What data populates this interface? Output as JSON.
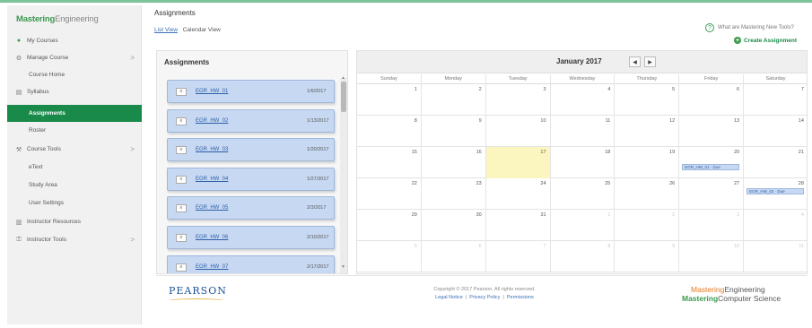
{
  "app": {
    "logo_primary": "Mastering",
    "logo_secondary": "Engineering",
    "accent": "#1a8a4a",
    "brand_green": "#3a9a4e"
  },
  "sidebar": {
    "items": [
      {
        "label": "My Courses",
        "icon": "home-icon"
      },
      {
        "label": "Manage Course",
        "icon": "wrench-icon",
        "chevron": ">"
      },
      {
        "label": "Course Home"
      },
      {
        "label": "Syllabus",
        "icon": "document-icon"
      },
      {
        "label": "Assignments",
        "active": true
      },
      {
        "label": "Roster"
      },
      {
        "label": "Course Tools",
        "icon": "tools-icon",
        "chevron": ">"
      },
      {
        "label": "eText"
      },
      {
        "label": "Study Area"
      },
      {
        "label": "User Settings"
      },
      {
        "label": "Instructor Resources",
        "icon": "book-icon"
      },
      {
        "label": "Instructor Tools",
        "icon": "key-icon",
        "chevron": ">"
      }
    ]
  },
  "header": {
    "title": "Assignments",
    "view_list": "List View",
    "view_calendar": "Calendar View",
    "whats_new": "What are Mastering New Tools?",
    "create_assignment": "Create Assignment"
  },
  "assignments": {
    "heading": "Assignments",
    "items": [
      {
        "name": "EGR_HW_01",
        "date": "1/6/2017"
      },
      {
        "name": "EGR_HW_02",
        "date": "1/13/2017"
      },
      {
        "name": "EGR_HW_03",
        "date": "1/20/2017"
      },
      {
        "name": "EGR_HW_04",
        "date": "1/27/2017"
      },
      {
        "name": "EGR_HW_05",
        "date": "2/3/2017"
      },
      {
        "name": "EGR_HW_06",
        "date": "2/10/2017"
      },
      {
        "name": "EGR_HW_07",
        "date": "2/17/2017"
      }
    ]
  },
  "calendar": {
    "month": "January 2017",
    "prev": "◀",
    "next": "▶",
    "days": [
      "Sunday",
      "Monday",
      "Tuesday",
      "Wednesday",
      "Thursday",
      "Friday",
      "Saturday"
    ],
    "weeks": [
      [
        "1",
        "2",
        "3",
        "4",
        "5",
        "6",
        "7"
      ],
      [
        "8",
        "9",
        "10",
        "11",
        "12",
        "13",
        "14"
      ],
      [
        "15",
        "16",
        "17",
        "18",
        "19",
        "20",
        "21"
      ],
      [
        "22",
        "23",
        "24",
        "25",
        "26",
        "27",
        "28"
      ],
      [
        "29",
        "30",
        "31",
        "1",
        "2",
        "3",
        "4"
      ],
      [
        "5",
        "6",
        "7",
        "8",
        "9",
        "10",
        "11"
      ]
    ],
    "events": {
      "wk2_fri": "EGR_HW_01 · Due",
      "wk3_fri": "EGR_HW_02 · Due"
    }
  },
  "footer": {
    "brand": "PEARSON",
    "copyright": "Copyright © 2017 Pearson. All rights reserved.",
    "links": [
      "Legal Notice",
      "Privacy Policy",
      "Permissions"
    ],
    "brand_line1_a": "Mastering",
    "brand_line1_b": "Engineering",
    "brand_line2_a": "Mastering",
    "brand_line2_b": "Computer Science"
  }
}
